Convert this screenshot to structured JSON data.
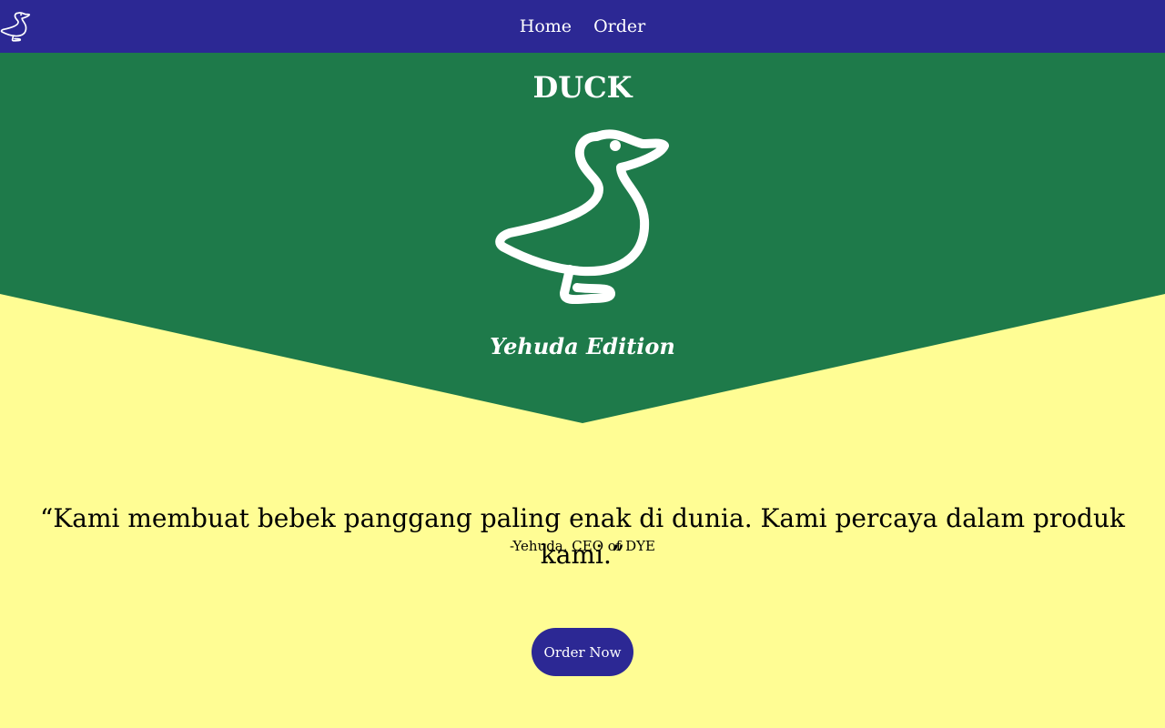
{
  "nav": {
    "logo_icon": "duck-icon",
    "links": [
      "Home",
      "Order"
    ]
  },
  "hero": {
    "title": "DUCK",
    "illustration_icon": "duck-outline",
    "subtitle": "Yehuda Edition"
  },
  "quote": {
    "text": "“Kami membuat bebek panggang paling enak di dunia. Kami percaya dalam produk kami.”",
    "author": "-Yehuda, CEO of DYE"
  },
  "cta": {
    "label": "Order Now"
  },
  "colors": {
    "navbar": "#2c2894",
    "hero": "#1e7a4a",
    "page_background": "#fffd94",
    "button": "#2c2894",
    "text_light": "#ffffff",
    "text_dark": "#000000"
  }
}
